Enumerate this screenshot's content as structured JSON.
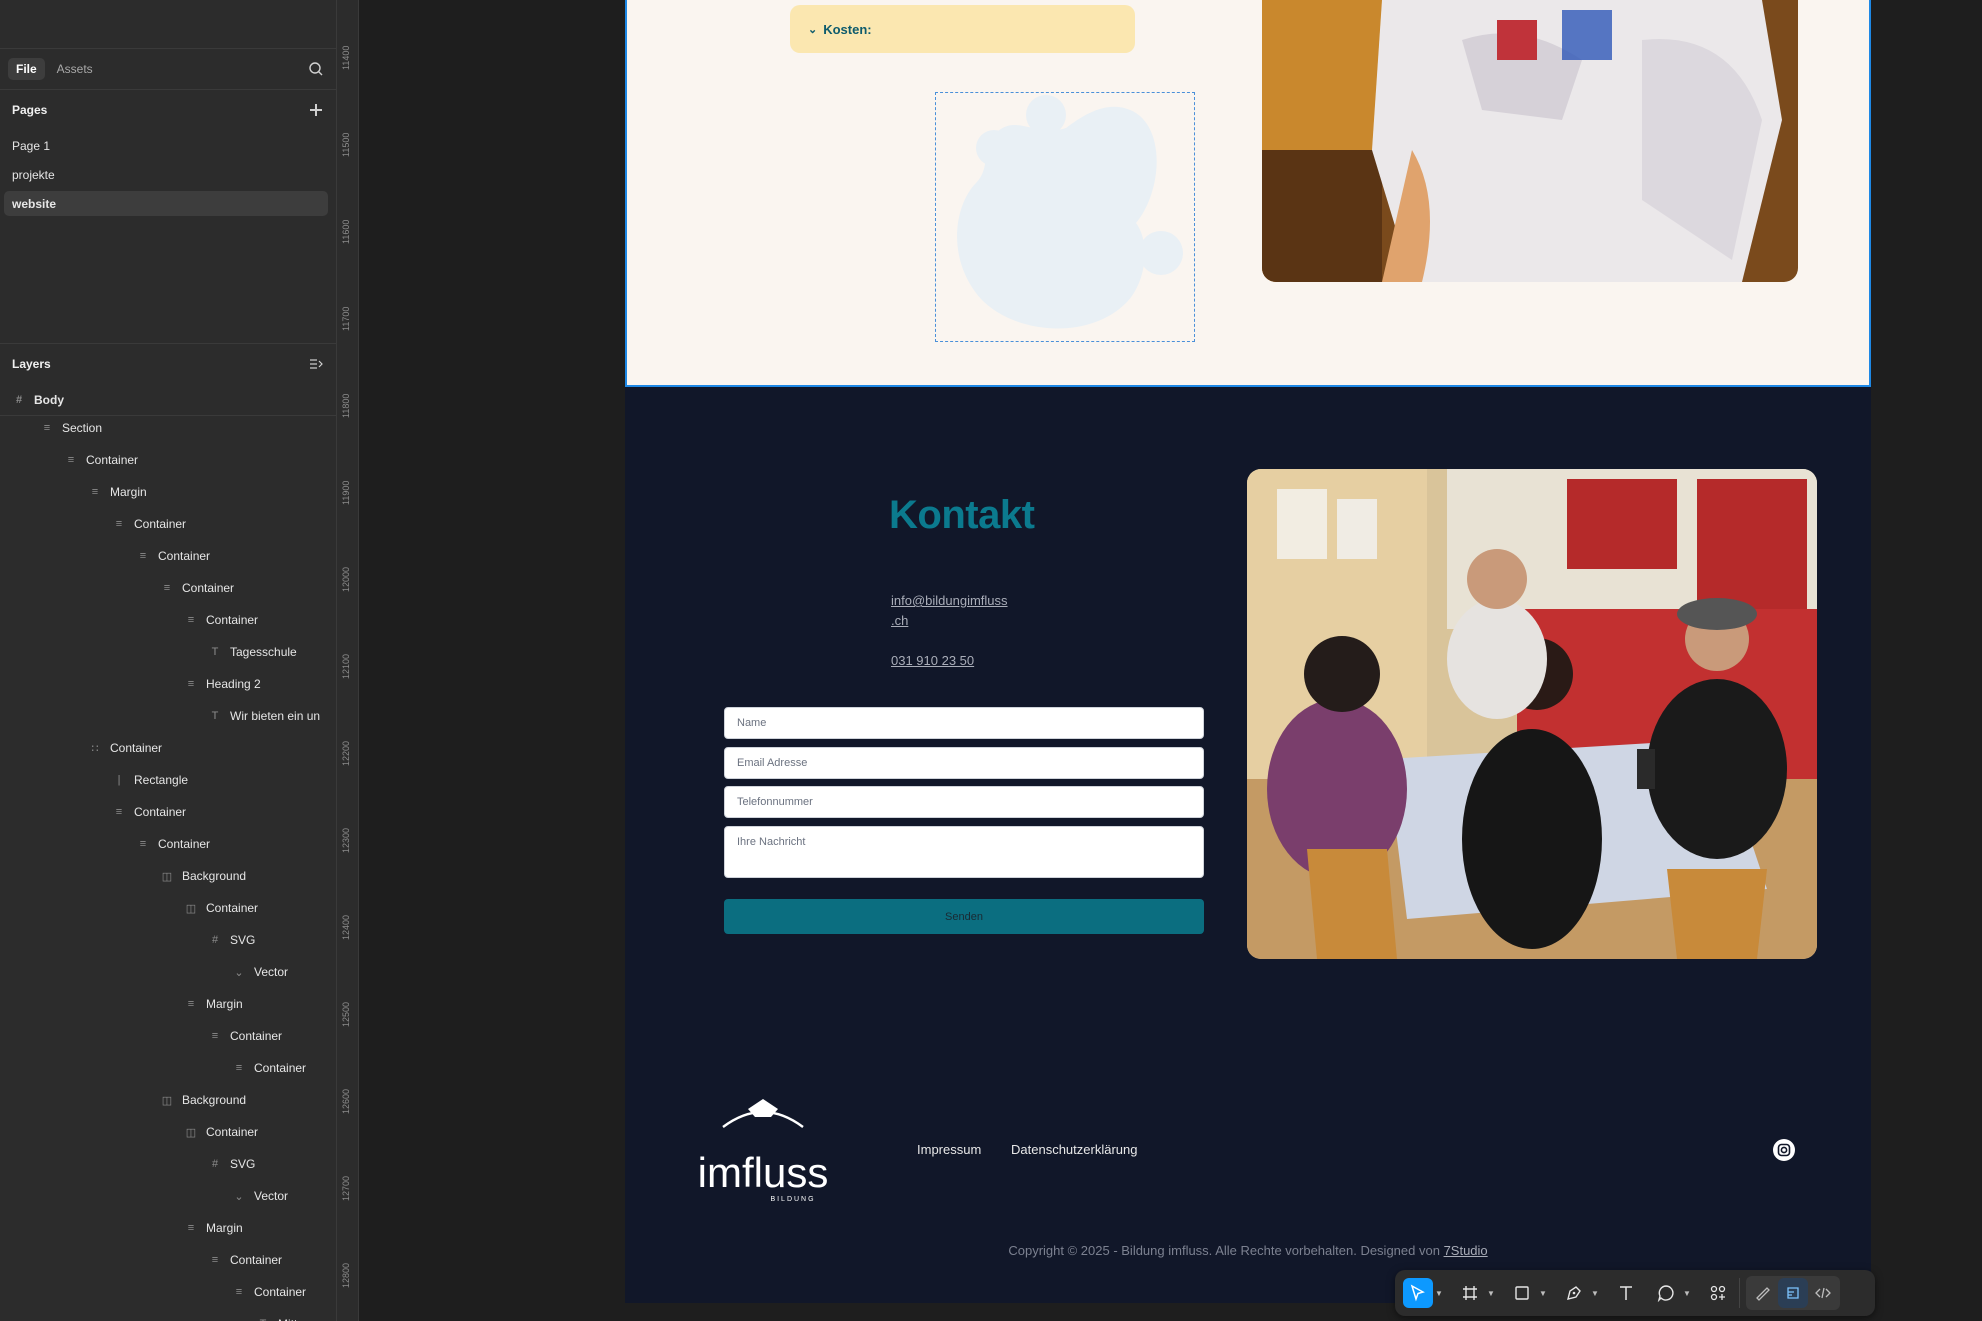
{
  "left_panel": {
    "tabs": [
      {
        "label": "File",
        "active": true
      },
      {
        "label": "Assets",
        "active": false
      }
    ],
    "pages_title": "Pages",
    "pages": [
      {
        "label": "Page 1",
        "active": false
      },
      {
        "label": "projekte",
        "active": false
      },
      {
        "label": "website",
        "active": true
      }
    ],
    "layers_title": "Layers",
    "body_label": "Body",
    "layers": [
      {
        "label": "Section",
        "indent": 1,
        "icon": "stack-icon"
      },
      {
        "label": "Container",
        "indent": 2,
        "icon": "stack-icon"
      },
      {
        "label": "Margin",
        "indent": 3,
        "icon": "stack-icon"
      },
      {
        "label": "Container",
        "indent": 4,
        "icon": "stack-icon"
      },
      {
        "label": "Container",
        "indent": 5,
        "icon": "stack-icon"
      },
      {
        "label": "Container",
        "indent": 6,
        "icon": "stack-icon"
      },
      {
        "label": "Container",
        "indent": 7,
        "icon": "stack-icon"
      },
      {
        "label": "Tagesschule",
        "indent": 8,
        "icon": "text-icon"
      },
      {
        "label": "Heading 2",
        "indent": 7,
        "icon": "stack-icon"
      },
      {
        "label": "Wir bieten ein un",
        "indent": 8,
        "icon": "text-icon"
      },
      {
        "label": "Container",
        "indent": 3,
        "icon": "grid-icon"
      },
      {
        "label": "Rectangle",
        "indent": 4,
        "icon": "line-icon"
      },
      {
        "label": "Container",
        "indent": 4,
        "icon": "stack-icon"
      },
      {
        "label": "Container",
        "indent": 5,
        "icon": "stack-icon"
      },
      {
        "label": "Background",
        "indent": 6,
        "icon": "columns-icon"
      },
      {
        "label": "Container",
        "indent": 7,
        "icon": "columns-icon"
      },
      {
        "label": "SVG",
        "indent": 8,
        "icon": "frame-icon"
      },
      {
        "label": "Vector",
        "indent": 9,
        "icon": "vector-icon"
      },
      {
        "label": "Margin",
        "indent": 7,
        "icon": "stack-icon"
      },
      {
        "label": "Container",
        "indent": 8,
        "icon": "stack-icon"
      },
      {
        "label": "Container",
        "indent": 9,
        "icon": "stack-icon"
      },
      {
        "label": "Background",
        "indent": 6,
        "icon": "columns-icon"
      },
      {
        "label": "Container",
        "indent": 7,
        "icon": "columns-icon"
      },
      {
        "label": "SVG",
        "indent": 8,
        "icon": "frame-icon"
      },
      {
        "label": "Vector",
        "indent": 9,
        "icon": "vector-icon"
      },
      {
        "label": "Margin",
        "indent": 7,
        "icon": "stack-icon"
      },
      {
        "label": "Container",
        "indent": 8,
        "icon": "stack-icon"
      },
      {
        "label": "Container",
        "indent": 9,
        "icon": "stack-icon"
      },
      {
        "label": "Mittag",
        "indent": 10,
        "icon": "text-icon"
      }
    ]
  },
  "ruler": {
    "labels": [
      "11400",
      "11500",
      "11600",
      "11700",
      "11800",
      "11900",
      "12000",
      "12100",
      "12200",
      "12300",
      "12400",
      "12500",
      "12600",
      "12700",
      "12800"
    ]
  },
  "website": {
    "kosten_label": "Kosten:",
    "kontakt_title": "Kontakt",
    "email_line1": "info@bildungimfluss",
    "email_line2": ".ch",
    "phone": "031 910 23 50",
    "form": {
      "name_placeholder": "Name",
      "email_placeholder": "Email Adresse",
      "phone_placeholder": "Telefonnummer",
      "message_placeholder": "Ihre Nachricht",
      "submit_label": "Senden"
    },
    "footer": {
      "logo_text": "imfluss",
      "logo_subtext": "BILDUNG",
      "links": [
        "Impressum",
        "Datenschutzerklärung"
      ],
      "copyright_text": "Copyright © 2025 - Bildung imfluss. Alle Rechte vorbehalten. Designed von ",
      "designer_link": "7Studio"
    }
  },
  "colors": {
    "accent": "#0d99ff",
    "teal": "#0b7a8e",
    "navy": "#111729",
    "cream": "#faf5f0",
    "kosten_bg": "#fbe7b0"
  }
}
